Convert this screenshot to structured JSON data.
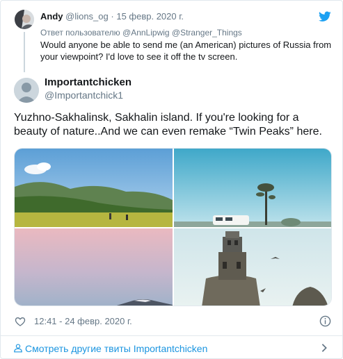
{
  "parent_tweet": {
    "author_name": "Andy",
    "author_handle": "@lions_og",
    "separator": "·",
    "date": "15 февр. 2020 г.",
    "reply_prefix": "Ответ пользователю ",
    "reply_handles": "@AnnLipwig @Stranger_Things",
    "text": "Would anyone be able to send me (an American) pictures of Russia from your viewpoint? I'd love to see it off the tv screen."
  },
  "tweet": {
    "author_name": "Importantchicken",
    "author_handle": "@Importantchick1",
    "text": "Yuzhno-Sakhalinsk, Sakhalin island. If you're looking for a beauty of nature..And we can even remake “Twin Peaks” here.",
    "timestamp": "12:41 - 24 февр. 2020 г.",
    "photos": [
      {
        "name": "meadow-hills-photo"
      },
      {
        "name": "van-tree-sky-photo"
      },
      {
        "name": "pink-sky-mountain-photo"
      },
      {
        "name": "lighthouse-ruin-photo"
      }
    ]
  },
  "footer": {
    "more_tweets_label": "Смотреть другие твиты Importantchicken"
  },
  "icons": {
    "brand": "twitter-bird-icon",
    "like": "heart-icon",
    "info": "info-icon",
    "profile": "person-icon",
    "chevron": "chevron-right-icon"
  },
  "colors": {
    "link": "#1b95e0",
    "twitter_blue": "#1da1f2",
    "secondary_text": "#657786",
    "border": "#e1e8ed"
  }
}
